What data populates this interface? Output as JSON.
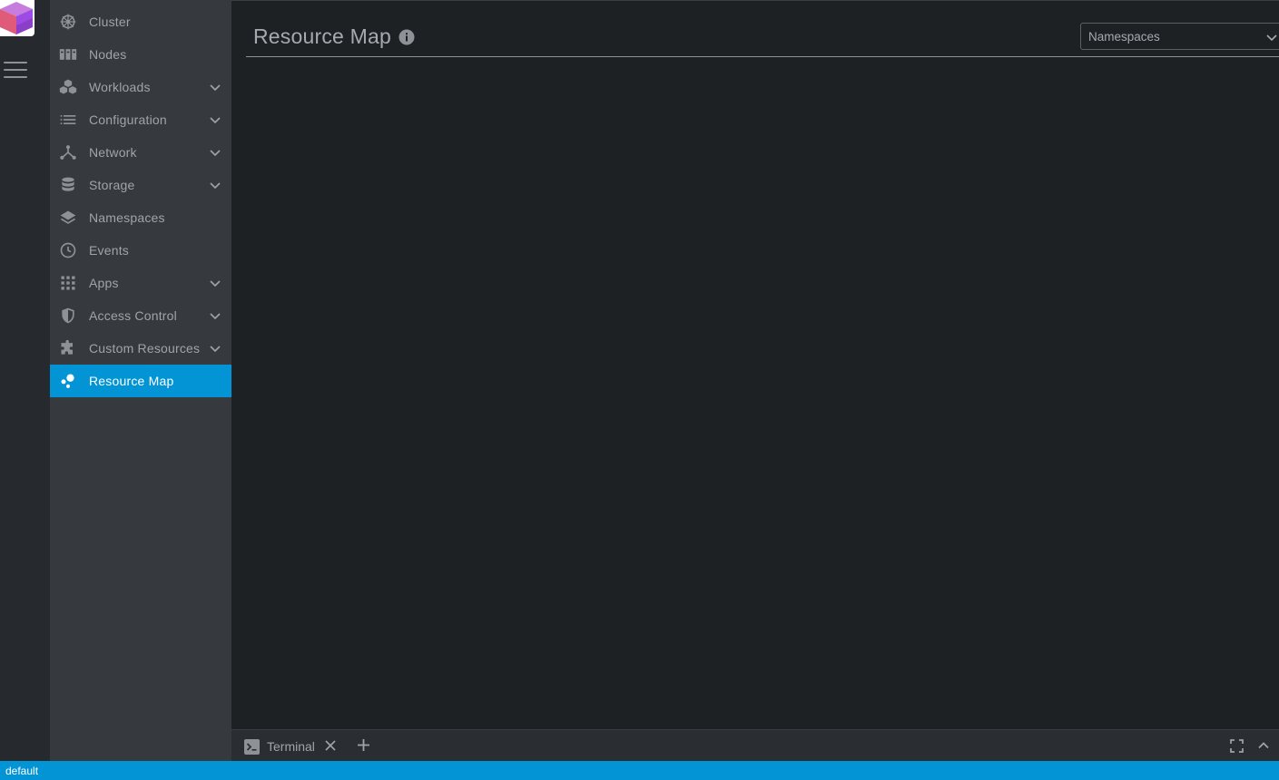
{
  "colors": {
    "accent": "#0294d4",
    "sidebar_bg": "#36393e",
    "rail_bg": "#262a2e",
    "main_bg": "#1e2124",
    "text_muted": "#8e9297"
  },
  "sidebar": {
    "items": [
      {
        "label": "Cluster",
        "icon": "helm-wheel-icon",
        "has_chevron": false,
        "active": false
      },
      {
        "label": "Nodes",
        "icon": "server-rack-icon",
        "has_chevron": false,
        "active": false
      },
      {
        "label": "Workloads",
        "icon": "cubes-icon",
        "has_chevron": true,
        "active": false
      },
      {
        "label": "Configuration",
        "icon": "list-icon",
        "has_chevron": true,
        "active": false
      },
      {
        "label": "Network",
        "icon": "network-icon",
        "has_chevron": true,
        "active": false
      },
      {
        "label": "Storage",
        "icon": "database-icon",
        "has_chevron": true,
        "active": false
      },
      {
        "label": "Namespaces",
        "icon": "layers-icon",
        "has_chevron": false,
        "active": false
      },
      {
        "label": "Events",
        "icon": "clock-icon",
        "has_chevron": false,
        "active": false
      },
      {
        "label": "Apps",
        "icon": "apps-grid-icon",
        "has_chevron": true,
        "active": false
      },
      {
        "label": "Access Control",
        "icon": "shield-icon",
        "has_chevron": true,
        "active": false
      },
      {
        "label": "Custom Resources",
        "icon": "puzzle-icon",
        "has_chevron": true,
        "active": false
      },
      {
        "label": "Resource Map",
        "icon": "bubbles-icon",
        "has_chevron": false,
        "active": true
      }
    ]
  },
  "main": {
    "title": "Resource Map",
    "namespace_select": {
      "value": "Namespaces"
    }
  },
  "dock": {
    "tab_label": "Terminal"
  },
  "statusbar": {
    "context": "default"
  }
}
